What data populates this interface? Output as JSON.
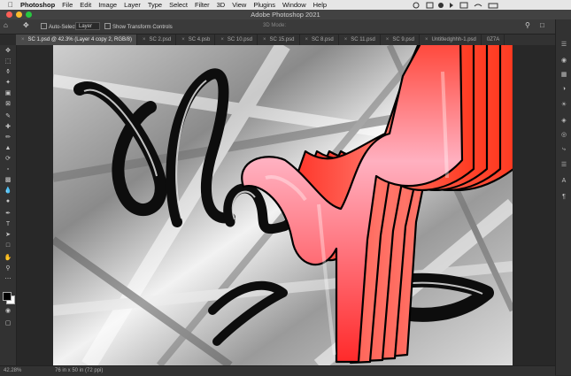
{
  "menubar": {
    "app_name": "Photoshop",
    "items": [
      "File",
      "Edit",
      "Image",
      "Layer",
      "Type",
      "Select",
      "Filter",
      "3D",
      "View",
      "Plugins",
      "Window",
      "Help"
    ]
  },
  "window": {
    "title": "Adobe Photoshop 2021"
  },
  "options_bar": {
    "auto_select_label": "Auto-Select:",
    "auto_select_value": "Layer",
    "transform_controls_label": "Show Transform Controls",
    "mode_label": "3D Mode:"
  },
  "tabs": [
    {
      "label": "SC 1.psd @ 42.3% (Layer 4 copy 2, RGB/8)",
      "active": true
    },
    {
      "label": "SC 2.psd",
      "active": false
    },
    {
      "label": "SC 4.psb",
      "active": false
    },
    {
      "label": "SC 10.psd",
      "active": false
    },
    {
      "label": "SC 15.psd",
      "active": false
    },
    {
      "label": "SC 8.psd",
      "active": false
    },
    {
      "label": "SC 11.psd",
      "active": false
    },
    {
      "label": "SC 9.psd",
      "active": false
    },
    {
      "label": "Untitledghhh-1.psd",
      "active": false
    },
    {
      "label": "0Z7A",
      "active": false
    }
  ],
  "status": {
    "zoom": "42.28%",
    "doc_size": "76 in x 50 in (72 ppi)"
  },
  "colors": {
    "foreground": "#000000",
    "background": "#ffffff",
    "art_red": "#ff4a33"
  },
  "toolbar_icons": [
    "move-icon",
    "marquee-icon",
    "lasso-icon",
    "quick-select-icon",
    "crop-icon",
    "frame-icon",
    "eyedropper-icon",
    "healing-icon",
    "brush-icon",
    "stamp-icon",
    "history-brush-icon",
    "eraser-icon",
    "gradient-icon",
    "blur-icon",
    "dodge-icon",
    "pen-icon",
    "type-icon",
    "path-select-icon",
    "shape-icon",
    "hand-icon",
    "zoom-icon",
    "more-tools-icon"
  ],
  "panel_icons": [
    "libraries-icon",
    "color-icon",
    "swatches-icon",
    "adjustments-icon",
    "learn-icon",
    "layers-icon",
    "channels-icon",
    "paths-icon",
    "properties-icon",
    "character-icon",
    "paragraph-icon"
  ]
}
